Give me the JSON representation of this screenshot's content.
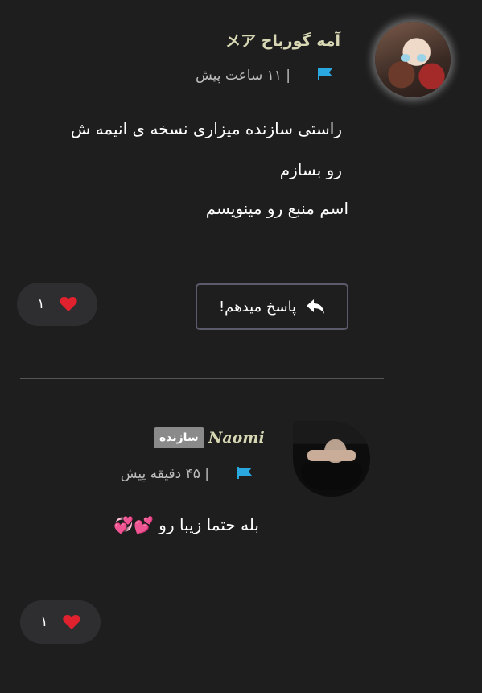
{
  "comments": [
    {
      "username": "メア آمه گورباح",
      "time": "| ۱۱ ساعت پیش",
      "lines": [
        "راستی سازنده میزاری نسخه ی انیمه ش",
        "رو بسازم",
        "اسم منبع رو مینویسم"
      ],
      "reply_label": "پاسخ میدهم!",
      "likes": "۱",
      "flag_color": "#29a9e0"
    },
    {
      "username": "Naomi",
      "badge": "سازنده",
      "time": "| ۴۵ دقیقه پیش",
      "lines": [
        "بله حتما زیبا رو 💕💞"
      ],
      "likes": "۱",
      "flag_color": "#29a9e0"
    }
  ],
  "colors": {
    "background": "#1e1e1f",
    "username": "#d8d7b4",
    "heart": "#e0212e"
  },
  "icons": [
    "flag-icon",
    "reply-arrow-icon",
    "heart-icon"
  ]
}
